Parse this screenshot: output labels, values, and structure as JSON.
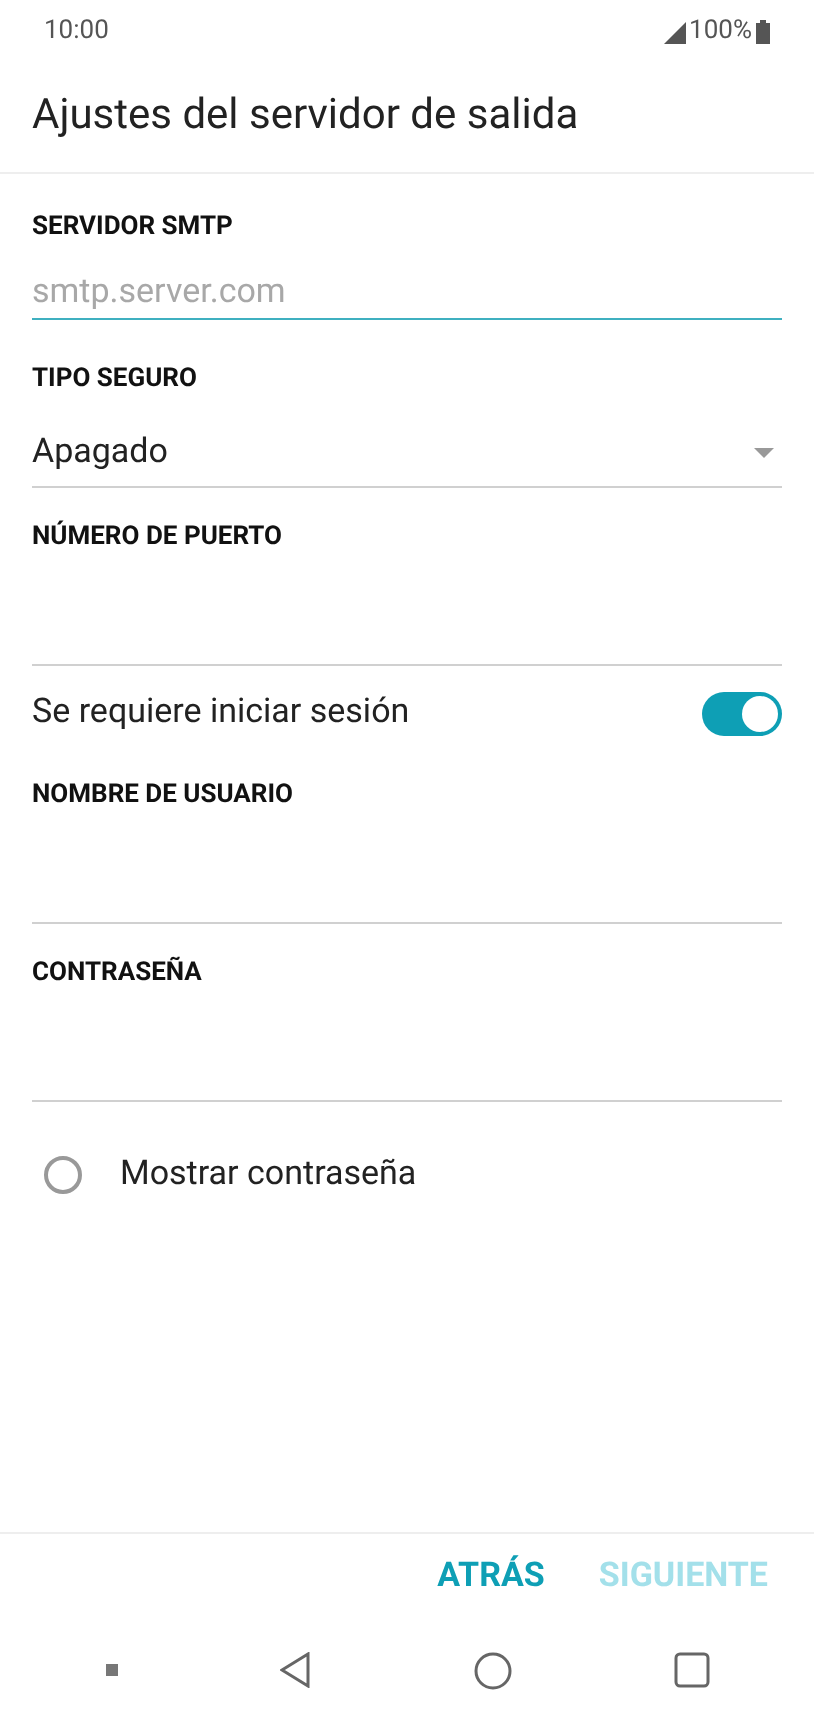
{
  "status_bar": {
    "time": "10:00",
    "battery": "100%"
  },
  "title": "Ajustes del servidor de salida",
  "fields": [
    {
      "kind": "text",
      "label": "SERVIDOR SMTP",
      "placeholder": "smtp.server.com",
      "focused": true
    },
    {
      "kind": "dropdown",
      "label": "TIPO SEGURO",
      "value": "Apagado"
    },
    {
      "kind": "text",
      "label": "NÚMERO DE PUERTO",
      "focused": false
    },
    {
      "kind": "switch",
      "label": "Se requiere iniciar sesión",
      "on": true
    },
    {
      "kind": "text",
      "label": "NOMBRE DE USUARIO",
      "focused": false
    },
    {
      "kind": "text",
      "label": "CONTRASEÑA",
      "focused": false
    }
  ],
  "show_password": {
    "label": "Mostrar contraseña",
    "checked": false
  },
  "buttons": [
    {
      "label": "ATRÁS",
      "disabled": false
    },
    {
      "label": "SIGUIENTE",
      "disabled": true
    }
  ]
}
